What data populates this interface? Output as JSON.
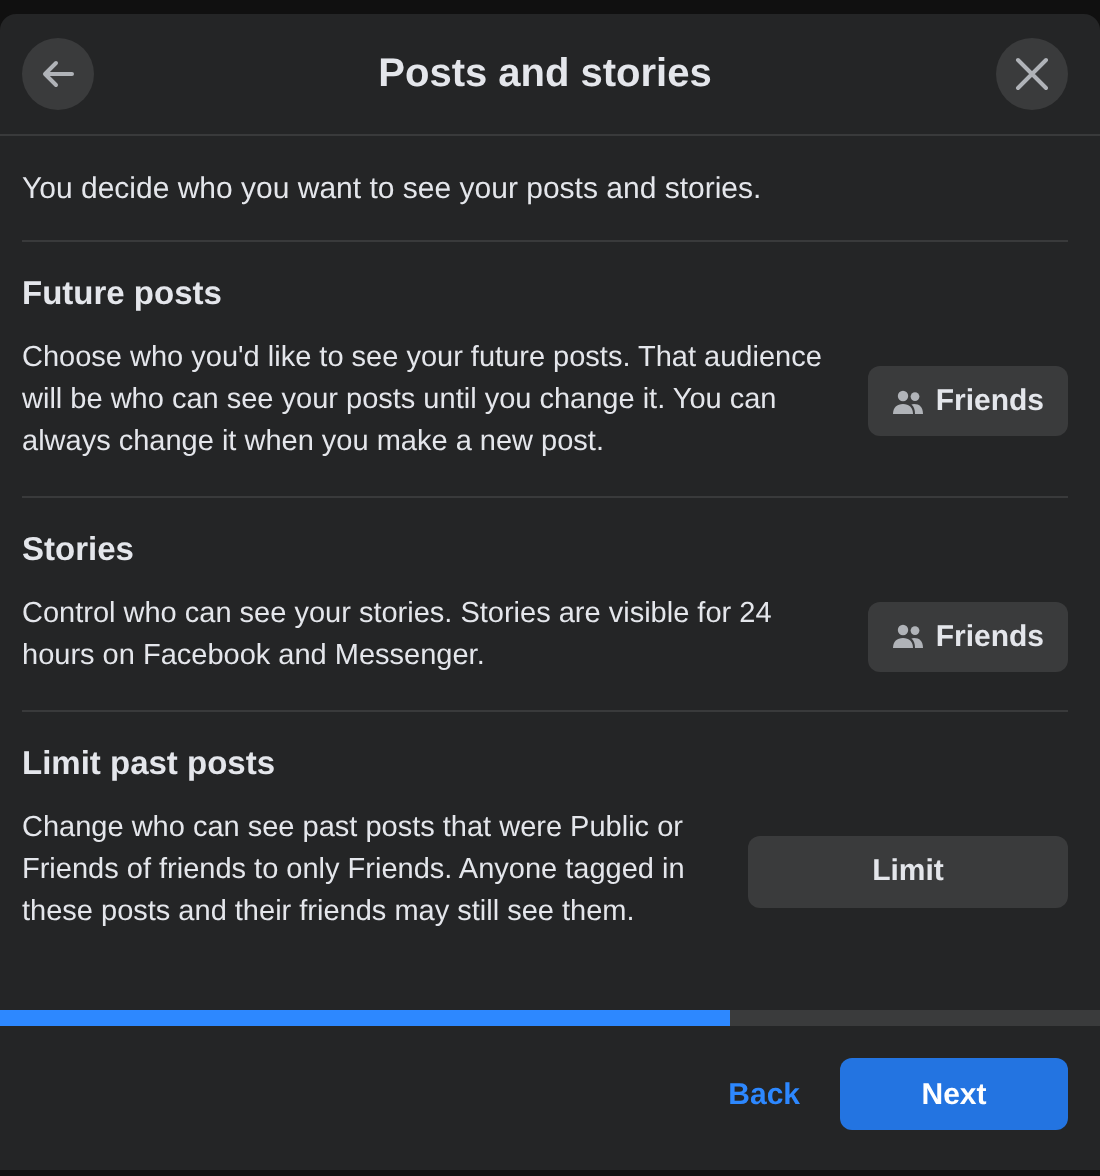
{
  "dialog": {
    "title": "Posts and stories",
    "intro": "You decide who you want to see your posts and stories."
  },
  "sections": [
    {
      "kind": "audience",
      "title": "Future posts",
      "description": "Choose who you'd like to see your future posts. That audience will be who can see your posts until you change it. You can always change it when you make a new post.",
      "button": "Friends"
    },
    {
      "kind": "audience",
      "title": "Stories",
      "description": "Control who can see your stories. Stories are visible for 24 hours on Facebook and Messenger.",
      "button": "Friends"
    },
    {
      "kind": "limit",
      "title": "Limit past posts",
      "description": "Change who can see past posts that were Public or Friends of friends to only Friends. Anyone tagged in these posts and their friends may still see them.",
      "button": "Limit"
    }
  ],
  "progress": {
    "level": 0.664
  },
  "footer": {
    "back": "Back",
    "next": "Next"
  }
}
